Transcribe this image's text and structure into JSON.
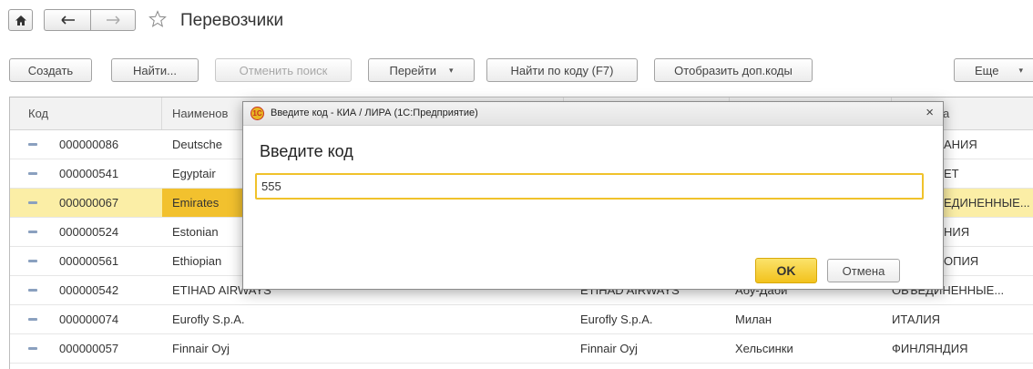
{
  "header": {
    "title": "Перевозчики"
  },
  "toolbar": {
    "create": "Создать",
    "find": "Найти...",
    "cancel_search": "Отменить поиск",
    "goto": "Перейти",
    "find_by_code": "Найти по коду (F7)",
    "show_codes": "Отобразить доп.коды",
    "more": "Еще"
  },
  "grid": {
    "columns": [
      "Код",
      "Наименов",
      "",
      "",
      "а"
    ],
    "rows": [
      {
        "code": "000000086",
        "name": "Deutsche",
        "full": "",
        "city": "",
        "country": "АНИЯ"
      },
      {
        "code": "000000541",
        "name": "Egyptair",
        "full": "",
        "city": "",
        "country": "ЕТ"
      },
      {
        "code": "000000067",
        "name": "Emirates",
        "full": "",
        "city": "",
        "country": "ЕДИНЕННЫЕ..."
      },
      {
        "code": "000000524",
        "name": "Estonian",
        "full": "",
        "city": "",
        "country": "НИЯ"
      },
      {
        "code": "000000561",
        "name": "Ethiopian",
        "full": "",
        "city": "",
        "country": "ОПИЯ"
      },
      {
        "code": "000000542",
        "name": "ETIHAD AIRWAYS",
        "full": "ETIHAD AIRWAYS",
        "city": "Абу-Даби",
        "country": "ОБЪЕДИНЕННЫЕ..."
      },
      {
        "code": "000000074",
        "name": "Eurofly S.p.A.",
        "full": "Eurofly S.p.A.",
        "city": "Милан",
        "country": "ИТАЛИЯ"
      },
      {
        "code": "000000057",
        "name": "Finnair Oyj",
        "full": "Finnair Oyj",
        "city": "Хельсинки",
        "country": "ФИНЛЯНДИЯ"
      }
    ]
  },
  "dialog": {
    "window_title": "Введите код - КИА / ЛИРА  (1С:Предприятие)",
    "logo_text": "1С",
    "heading": "Введите код",
    "input_value": "555",
    "ok": "OK",
    "cancel": "Отмена",
    "close_glyph": "×"
  },
  "colors": {
    "selection": "#fbeea6",
    "accent": "#f2c21c"
  }
}
